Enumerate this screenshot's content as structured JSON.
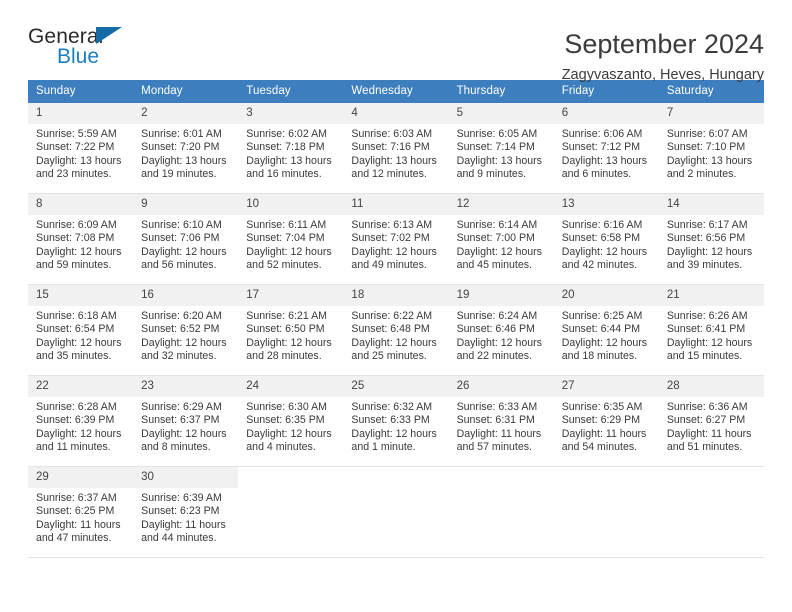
{
  "brand": {
    "name_top": "General",
    "name_bottom": "Blue",
    "triangle_color": "#156aa8",
    "blue_color": "#1b7ec2"
  },
  "header": {
    "title": "September 2024",
    "location": "Zagyvaszanto, Heves, Hungary"
  },
  "theme": {
    "header_row_bg": "#3d7ebe",
    "header_row_text": "#ffffff",
    "daynum_bg": "#f1f1f1",
    "cell_bg": "#ffffff",
    "row_divider": "#e3e3e3",
    "body_text": "#3a3a3a"
  },
  "weekdays": [
    "Sunday",
    "Monday",
    "Tuesday",
    "Wednesday",
    "Thursday",
    "Friday",
    "Saturday"
  ],
  "labels": {
    "sunrise_prefix": "Sunrise:",
    "sunset_prefix": "Sunset:",
    "daylight_prefix": "Daylight:"
  },
  "weeks": [
    [
      {
        "day": "1",
        "sunrise": "Sunrise: 5:59 AM",
        "sunset": "Sunset: 7:22 PM",
        "daylight_l1": "Daylight: 13 hours",
        "daylight_l2": "and 23 minutes."
      },
      {
        "day": "2",
        "sunrise": "Sunrise: 6:01 AM",
        "sunset": "Sunset: 7:20 PM",
        "daylight_l1": "Daylight: 13 hours",
        "daylight_l2": "and 19 minutes."
      },
      {
        "day": "3",
        "sunrise": "Sunrise: 6:02 AM",
        "sunset": "Sunset: 7:18 PM",
        "daylight_l1": "Daylight: 13 hours",
        "daylight_l2": "and 16 minutes."
      },
      {
        "day": "4",
        "sunrise": "Sunrise: 6:03 AM",
        "sunset": "Sunset: 7:16 PM",
        "daylight_l1": "Daylight: 13 hours",
        "daylight_l2": "and 12 minutes."
      },
      {
        "day": "5",
        "sunrise": "Sunrise: 6:05 AM",
        "sunset": "Sunset: 7:14 PM",
        "daylight_l1": "Daylight: 13 hours",
        "daylight_l2": "and 9 minutes."
      },
      {
        "day": "6",
        "sunrise": "Sunrise: 6:06 AM",
        "sunset": "Sunset: 7:12 PM",
        "daylight_l1": "Daylight: 13 hours",
        "daylight_l2": "and 6 minutes."
      },
      {
        "day": "7",
        "sunrise": "Sunrise: 6:07 AM",
        "sunset": "Sunset: 7:10 PM",
        "daylight_l1": "Daylight: 13 hours",
        "daylight_l2": "and 2 minutes."
      }
    ],
    [
      {
        "day": "8",
        "sunrise": "Sunrise: 6:09 AM",
        "sunset": "Sunset: 7:08 PM",
        "daylight_l1": "Daylight: 12 hours",
        "daylight_l2": "and 59 minutes."
      },
      {
        "day": "9",
        "sunrise": "Sunrise: 6:10 AM",
        "sunset": "Sunset: 7:06 PM",
        "daylight_l1": "Daylight: 12 hours",
        "daylight_l2": "and 56 minutes."
      },
      {
        "day": "10",
        "sunrise": "Sunrise: 6:11 AM",
        "sunset": "Sunset: 7:04 PM",
        "daylight_l1": "Daylight: 12 hours",
        "daylight_l2": "and 52 minutes."
      },
      {
        "day": "11",
        "sunrise": "Sunrise: 6:13 AM",
        "sunset": "Sunset: 7:02 PM",
        "daylight_l1": "Daylight: 12 hours",
        "daylight_l2": "and 49 minutes."
      },
      {
        "day": "12",
        "sunrise": "Sunrise: 6:14 AM",
        "sunset": "Sunset: 7:00 PM",
        "daylight_l1": "Daylight: 12 hours",
        "daylight_l2": "and 45 minutes."
      },
      {
        "day": "13",
        "sunrise": "Sunrise: 6:16 AM",
        "sunset": "Sunset: 6:58 PM",
        "daylight_l1": "Daylight: 12 hours",
        "daylight_l2": "and 42 minutes."
      },
      {
        "day": "14",
        "sunrise": "Sunrise: 6:17 AM",
        "sunset": "Sunset: 6:56 PM",
        "daylight_l1": "Daylight: 12 hours",
        "daylight_l2": "and 39 minutes."
      }
    ],
    [
      {
        "day": "15",
        "sunrise": "Sunrise: 6:18 AM",
        "sunset": "Sunset: 6:54 PM",
        "daylight_l1": "Daylight: 12 hours",
        "daylight_l2": "and 35 minutes."
      },
      {
        "day": "16",
        "sunrise": "Sunrise: 6:20 AM",
        "sunset": "Sunset: 6:52 PM",
        "daylight_l1": "Daylight: 12 hours",
        "daylight_l2": "and 32 minutes."
      },
      {
        "day": "17",
        "sunrise": "Sunrise: 6:21 AM",
        "sunset": "Sunset: 6:50 PM",
        "daylight_l1": "Daylight: 12 hours",
        "daylight_l2": "and 28 minutes."
      },
      {
        "day": "18",
        "sunrise": "Sunrise: 6:22 AM",
        "sunset": "Sunset: 6:48 PM",
        "daylight_l1": "Daylight: 12 hours",
        "daylight_l2": "and 25 minutes."
      },
      {
        "day": "19",
        "sunrise": "Sunrise: 6:24 AM",
        "sunset": "Sunset: 6:46 PM",
        "daylight_l1": "Daylight: 12 hours",
        "daylight_l2": "and 22 minutes."
      },
      {
        "day": "20",
        "sunrise": "Sunrise: 6:25 AM",
        "sunset": "Sunset: 6:44 PM",
        "daylight_l1": "Daylight: 12 hours",
        "daylight_l2": "and 18 minutes."
      },
      {
        "day": "21",
        "sunrise": "Sunrise: 6:26 AM",
        "sunset": "Sunset: 6:41 PM",
        "daylight_l1": "Daylight: 12 hours",
        "daylight_l2": "and 15 minutes."
      }
    ],
    [
      {
        "day": "22",
        "sunrise": "Sunrise: 6:28 AM",
        "sunset": "Sunset: 6:39 PM",
        "daylight_l1": "Daylight: 12 hours",
        "daylight_l2": "and 11 minutes."
      },
      {
        "day": "23",
        "sunrise": "Sunrise: 6:29 AM",
        "sunset": "Sunset: 6:37 PM",
        "daylight_l1": "Daylight: 12 hours",
        "daylight_l2": "and 8 minutes."
      },
      {
        "day": "24",
        "sunrise": "Sunrise: 6:30 AM",
        "sunset": "Sunset: 6:35 PM",
        "daylight_l1": "Daylight: 12 hours",
        "daylight_l2": "and 4 minutes."
      },
      {
        "day": "25",
        "sunrise": "Sunrise: 6:32 AM",
        "sunset": "Sunset: 6:33 PM",
        "daylight_l1": "Daylight: 12 hours",
        "daylight_l2": "and 1 minute."
      },
      {
        "day": "26",
        "sunrise": "Sunrise: 6:33 AM",
        "sunset": "Sunset: 6:31 PM",
        "daylight_l1": "Daylight: 11 hours",
        "daylight_l2": "and 57 minutes."
      },
      {
        "day": "27",
        "sunrise": "Sunrise: 6:35 AM",
        "sunset": "Sunset: 6:29 PM",
        "daylight_l1": "Daylight: 11 hours",
        "daylight_l2": "and 54 minutes."
      },
      {
        "day": "28",
        "sunrise": "Sunrise: 6:36 AM",
        "sunset": "Sunset: 6:27 PM",
        "daylight_l1": "Daylight: 11 hours",
        "daylight_l2": "and 51 minutes."
      }
    ],
    [
      {
        "day": "29",
        "sunrise": "Sunrise: 6:37 AM",
        "sunset": "Sunset: 6:25 PM",
        "daylight_l1": "Daylight: 11 hours",
        "daylight_l2": "and 47 minutes."
      },
      {
        "day": "30",
        "sunrise": "Sunrise: 6:39 AM",
        "sunset": "Sunset: 6:23 PM",
        "daylight_l1": "Daylight: 11 hours",
        "daylight_l2": "and 44 minutes."
      },
      {
        "day": "",
        "sunrise": "",
        "sunset": "",
        "daylight_l1": "",
        "daylight_l2": ""
      },
      {
        "day": "",
        "sunrise": "",
        "sunset": "",
        "daylight_l1": "",
        "daylight_l2": ""
      },
      {
        "day": "",
        "sunrise": "",
        "sunset": "",
        "daylight_l1": "",
        "daylight_l2": ""
      },
      {
        "day": "",
        "sunrise": "",
        "sunset": "",
        "daylight_l1": "",
        "daylight_l2": ""
      },
      {
        "day": "",
        "sunrise": "",
        "sunset": "",
        "daylight_l1": "",
        "daylight_l2": ""
      }
    ]
  ]
}
